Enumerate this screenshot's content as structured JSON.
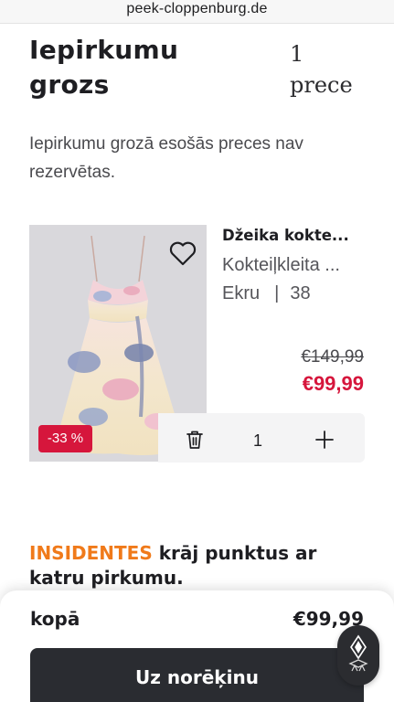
{
  "browser": {
    "url": "peek-cloppenburg.de"
  },
  "cart": {
    "title": "Iepirkumu grozs",
    "count_number": "1",
    "count_unit": "prece",
    "notice": "Iepirkumu grozā esošās preces nav rezervētas."
  },
  "item": {
    "brand": "Džeika kokte...",
    "name": "Kokteiļkleita ...",
    "color": "Ekru",
    "separator": "|",
    "size": "38",
    "discount_badge": "-33 %",
    "price_old": "€149,99",
    "price_new": "€99,99",
    "quantity": "1"
  },
  "promo": {
    "brand_word": "INSIDENTES",
    "text": " krāj punktus ar katru pirkumu."
  },
  "summary": {
    "total_label": "kopā",
    "total_value": "€99,99",
    "checkout_label": "Uz norēķinu"
  },
  "colors": {
    "accent_red": "#d6163c",
    "promo_orange": "#f07a1a",
    "button_dark": "#2a2c31"
  },
  "icons": [
    "heart-icon",
    "trash-icon",
    "plus-icon",
    "assistant-logo-icon"
  ]
}
